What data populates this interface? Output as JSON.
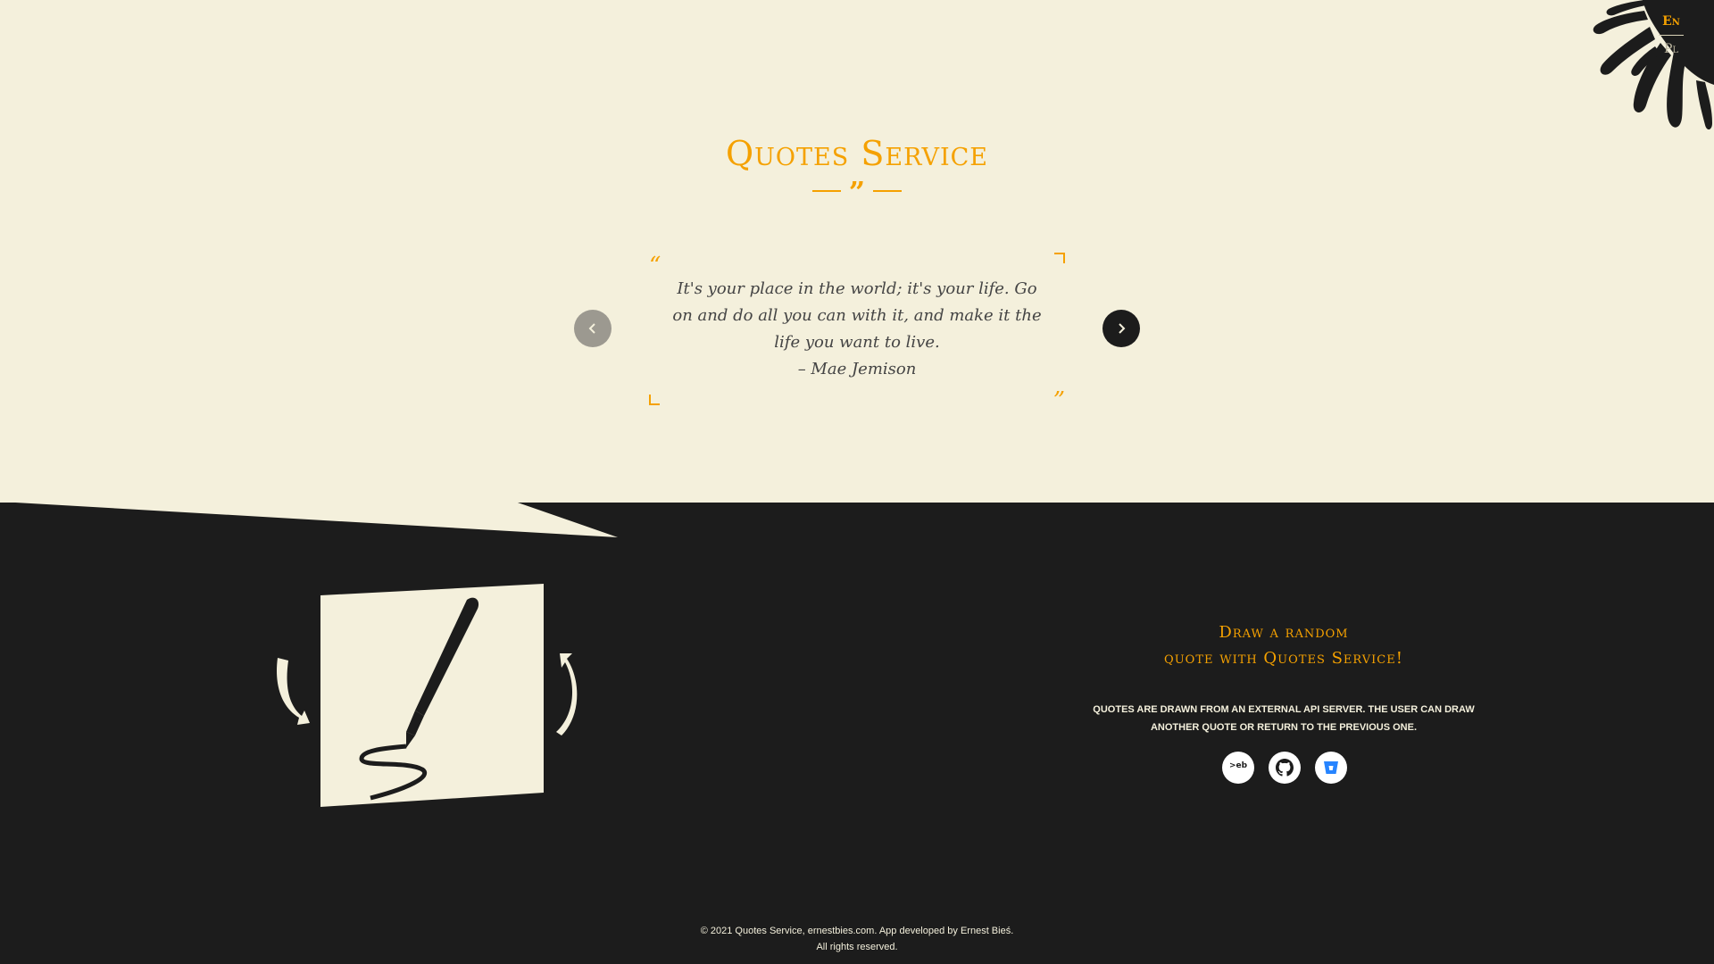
{
  "lang": {
    "en": "En",
    "pl": "Pl"
  },
  "header": {
    "title": "Quotes Service",
    "divider_glyph": "99"
  },
  "quote": {
    "text": "It's your place in the world; it's your life. Go on and do all you can with it, and make it the life you want to live.",
    "author": "– Mae Jemison",
    "open_mark": "“",
    "close_mark": "”"
  },
  "nav": {
    "prev_icon": "chevron-left-icon",
    "next_icon": "chevron-right-icon"
  },
  "cta": {
    "title_line1": "Draw a random",
    "title_line2": "quote with Quotes Service!",
    "description_line1": "Quotes are drawn from an external API server. The user can draw",
    "description_line2": "another quote or return to the previous one."
  },
  "socials": [
    {
      "name": "ernestbies-icon",
      "label": ">eb"
    },
    {
      "name": "github-icon",
      "label": ""
    },
    {
      "name": "bitbucket-icon",
      "label": ""
    }
  ],
  "footer": {
    "line1": "© 2021 Quotes Service, ernestbies.com. App developed by Ernest Bieś.",
    "line2": "All rights reserved."
  },
  "colors": {
    "accent": "#f5a100",
    "dark": "#1c1c1c",
    "cream": "#f4f0dc"
  }
}
